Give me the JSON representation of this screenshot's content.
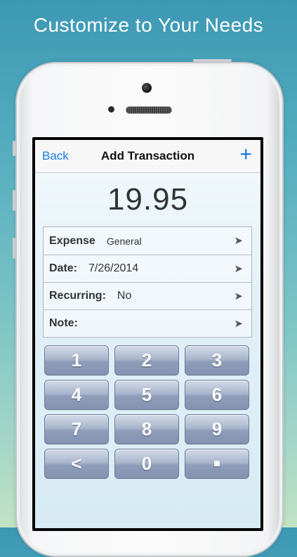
{
  "headline": "Customize to Your Needs",
  "navbar": {
    "back_label": "Back",
    "title": "Add Transaction",
    "add_label": "+"
  },
  "amount": "19.95",
  "form": {
    "rows": [
      {
        "label": "Expense",
        "value": "General",
        "icon": "arrow-icon"
      },
      {
        "label": "Date:",
        "value": "7/26/2014",
        "icon": "arrow-icon"
      },
      {
        "label": "Recurring:",
        "value": "No",
        "icon": "arrow-icon"
      },
      {
        "label": "Note:",
        "value": "",
        "icon": "arrow-icon"
      }
    ],
    "arrow_glyph": "➤"
  },
  "keypad": {
    "keys": [
      "1",
      "2",
      "3",
      "4",
      "5",
      "6",
      "7",
      "8",
      "9",
      "<",
      "0",
      "■"
    ]
  },
  "colors": {
    "accent": "#1a7ae0",
    "key_gradient_top": "#d4dbe9",
    "key_gradient_bottom": "#8392b0"
  }
}
